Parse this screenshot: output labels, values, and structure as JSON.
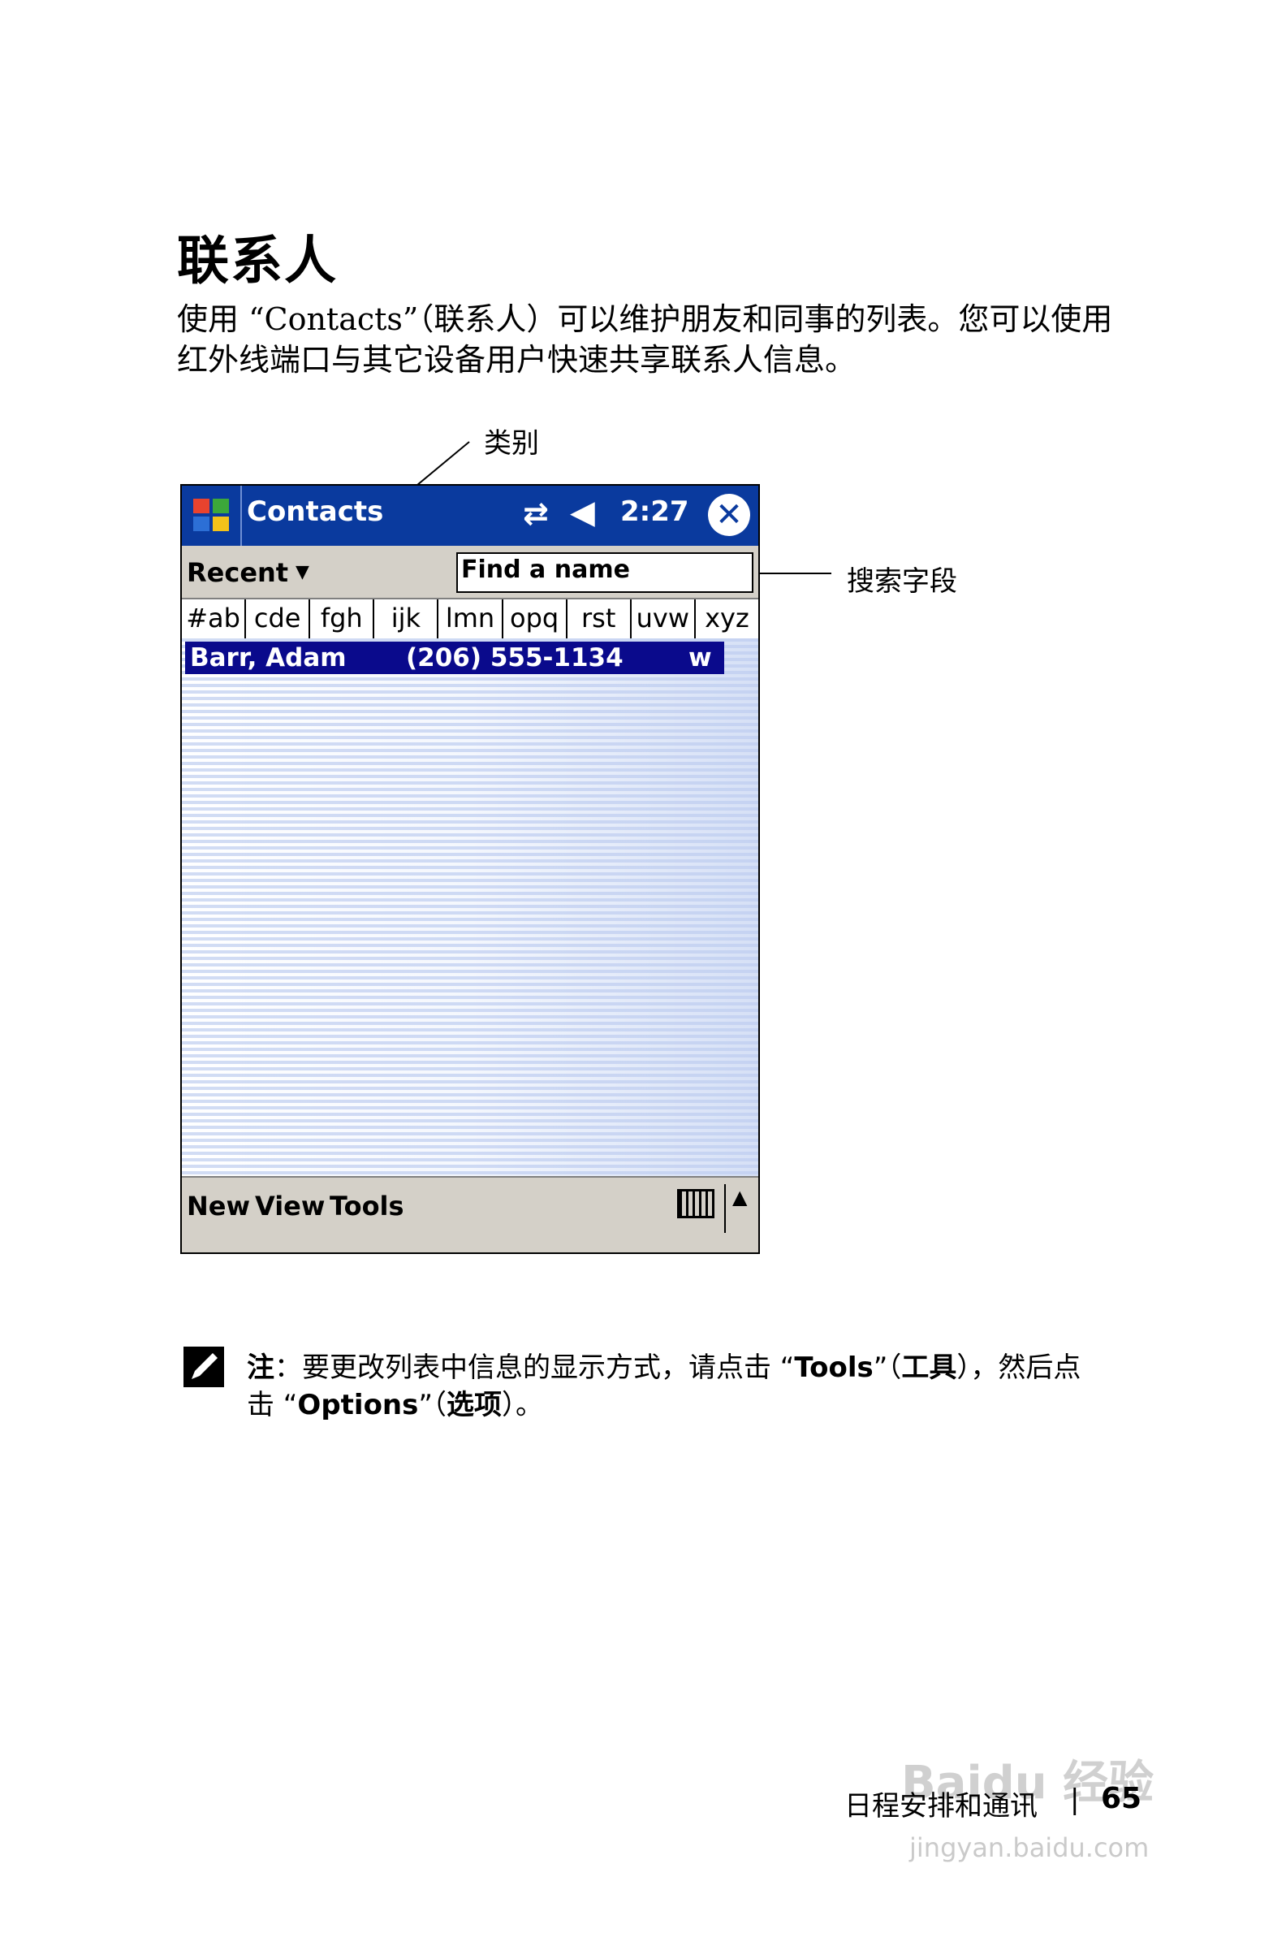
{
  "page": {
    "title": "联系人",
    "intro_line_1": "使用 “Contacts”（联系人）可以维护朋友和同事的列表。您可以使用",
    "intro_line_2": "红外线端口与其它设备用户快速共享联系人信息。"
  },
  "callouts": {
    "category": "类别",
    "search_field": "搜索字段"
  },
  "device": {
    "app_title": "Contacts",
    "clock": "2:27",
    "sync_icon": "⇄",
    "volume_icon": "◀",
    "close_label": "✕",
    "category_value": "Recent",
    "category_arrow": "▼",
    "search_placeholder": "Find a name",
    "alpha_tabs": [
      "#ab",
      "cde",
      "fgh",
      "ijk",
      "lmn",
      "opq",
      "rst",
      "uvw",
      "xyz"
    ],
    "contact": {
      "name": "Barr, Adam",
      "phone": "(206) 555-1134",
      "type": "w"
    },
    "menu": {
      "new": "New",
      "view": "View",
      "tools": "Tools"
    },
    "sip_arrow": "▲",
    "colors": {
      "titlebar": "#0a3a9e",
      "selection": "#0a0a8c",
      "chrome": "#d4d0c8"
    }
  },
  "note": {
    "label": "注",
    "text_a": "：要更改列表中信息的显示方式，请点击 “",
    "tools": "Tools",
    "text_b": "”（",
    "tools_cn": "工具",
    "text_c": "），然后点",
    "line2_a": "击 “",
    "options": "Options",
    "line2_b": "”（",
    "options_cn": "选项",
    "line2_c": "）。"
  },
  "footer": {
    "section": "日程安排和通讯",
    "separator": "|",
    "page_number": "65"
  },
  "watermark": {
    "brand": "Baidu 经验",
    "url": "jingyan.baidu.com"
  }
}
